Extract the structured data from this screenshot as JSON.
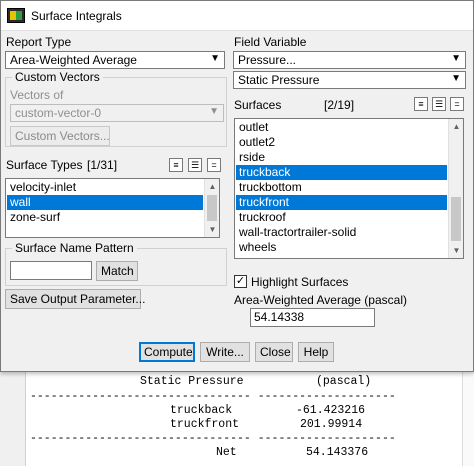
{
  "dialog": {
    "title": "Surface Integrals",
    "report_type": {
      "label": "Report Type",
      "value": "Area-Weighted Average"
    },
    "custom_vectors": {
      "legend": "Custom Vectors",
      "vectors_of_label": "Vectors of",
      "vectors_of_value": "custom-vector-0",
      "button": "Custom Vectors..."
    },
    "surface_types": {
      "label": "Surface Types",
      "count": "[1/31]",
      "items": [
        "velocity-inlet",
        "wall",
        "zone-surf"
      ],
      "selected_index": 1
    },
    "surface_name_pattern": {
      "legend": "Surface Name Pattern",
      "value": "",
      "match_button": "Match"
    },
    "save_output_button": "Save Output Parameter...",
    "field_variable": {
      "label": "Field Variable",
      "category": "Pressure...",
      "value": "Static Pressure"
    },
    "surfaces": {
      "label": "Surfaces",
      "count": "[2/19]",
      "items": [
        "outlet",
        "outlet2",
        "rside",
        "truckback",
        "truckbottom",
        "truckfront",
        "truckroof",
        "wall-tractortrailer-solid",
        "wheels"
      ],
      "selected": [
        3,
        5
      ]
    },
    "highlight_surfaces": {
      "label": "Highlight Surfaces",
      "checked": true
    },
    "result": {
      "label": "Area-Weighted Average (pascal)",
      "value": "54.14338"
    },
    "buttons": {
      "compute": "Compute",
      "write": "Write...",
      "close": "Close",
      "help": "Help"
    }
  },
  "console": {
    "header_left": "Static Pressure",
    "header_right": "(pascal)",
    "separator": "-------------------------------- --------------------",
    "rows": [
      {
        "name": "truckback",
        "value": "-61.423216"
      },
      {
        "name": "truckfront",
        "value": "201.99914"
      }
    ],
    "separator2": "---------------- --------------------",
    "total_name": "Net",
    "total_value": "54.143376"
  },
  "icons": {
    "select_all": "select-all-icon",
    "select_none": "deselect-all-icon",
    "list_filter": "list-filter-icon"
  }
}
